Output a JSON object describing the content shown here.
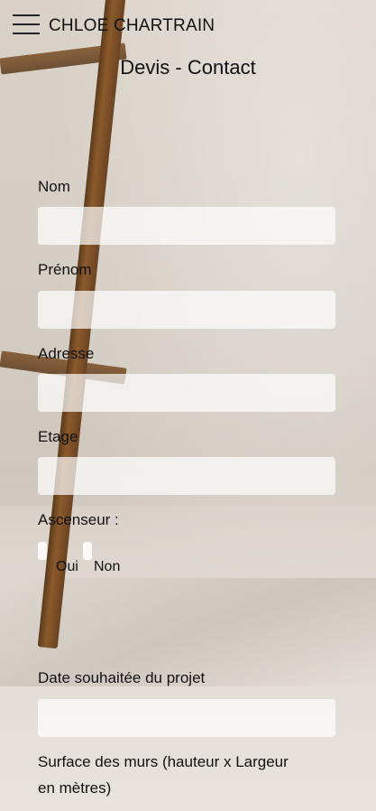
{
  "header": {
    "brand": "CHLOE CHARTRAIN",
    "menu_icon": "hamburger-menu-icon"
  },
  "page": {
    "title": "Devis - Contact"
  },
  "form": {
    "nom": {
      "label": "Nom",
      "value": ""
    },
    "prenom": {
      "label": "Prénom",
      "value": ""
    },
    "adresse": {
      "label": "Adresse",
      "value": ""
    },
    "etage": {
      "label": "Etage",
      "value": ""
    },
    "ascenseur": {
      "label": "Ascenseur :",
      "options": [
        "Oui",
        "Non"
      ]
    },
    "date": {
      "label": "Date souhaitée du projet",
      "value": ""
    },
    "surface": {
      "label_line1": "Surface des murs (hauteur x Largeur",
      "label_line2": "en mètres)"
    }
  }
}
